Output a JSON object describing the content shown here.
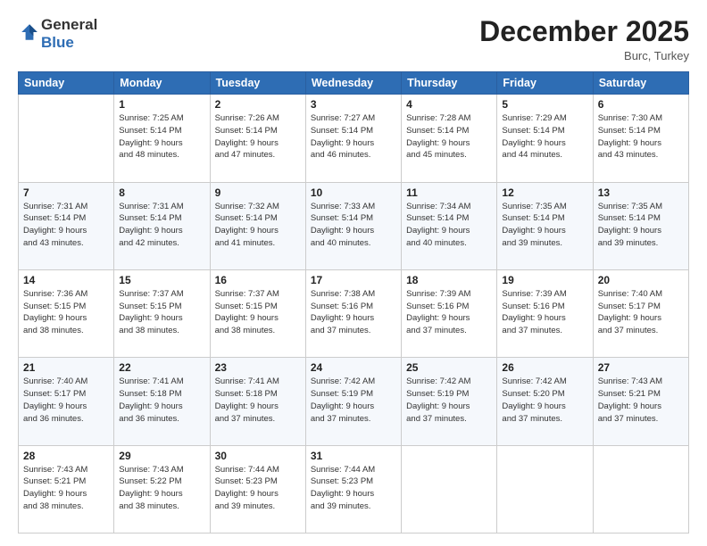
{
  "logo": {
    "line1": "General",
    "line2": "Blue"
  },
  "header": {
    "month": "December 2025",
    "location": "Burc, Turkey"
  },
  "days_of_week": [
    "Sunday",
    "Monday",
    "Tuesday",
    "Wednesday",
    "Thursday",
    "Friday",
    "Saturday"
  ],
  "weeks": [
    [
      {
        "day": "",
        "info": ""
      },
      {
        "day": "1",
        "info": "Sunrise: 7:25 AM\nSunset: 5:14 PM\nDaylight: 9 hours\nand 48 minutes."
      },
      {
        "day": "2",
        "info": "Sunrise: 7:26 AM\nSunset: 5:14 PM\nDaylight: 9 hours\nand 47 minutes."
      },
      {
        "day": "3",
        "info": "Sunrise: 7:27 AM\nSunset: 5:14 PM\nDaylight: 9 hours\nand 46 minutes."
      },
      {
        "day": "4",
        "info": "Sunrise: 7:28 AM\nSunset: 5:14 PM\nDaylight: 9 hours\nand 45 minutes."
      },
      {
        "day": "5",
        "info": "Sunrise: 7:29 AM\nSunset: 5:14 PM\nDaylight: 9 hours\nand 44 minutes."
      },
      {
        "day": "6",
        "info": "Sunrise: 7:30 AM\nSunset: 5:14 PM\nDaylight: 9 hours\nand 43 minutes."
      }
    ],
    [
      {
        "day": "7",
        "info": "Sunrise: 7:31 AM\nSunset: 5:14 PM\nDaylight: 9 hours\nand 43 minutes."
      },
      {
        "day": "8",
        "info": "Sunrise: 7:31 AM\nSunset: 5:14 PM\nDaylight: 9 hours\nand 42 minutes."
      },
      {
        "day": "9",
        "info": "Sunrise: 7:32 AM\nSunset: 5:14 PM\nDaylight: 9 hours\nand 41 minutes."
      },
      {
        "day": "10",
        "info": "Sunrise: 7:33 AM\nSunset: 5:14 PM\nDaylight: 9 hours\nand 40 minutes."
      },
      {
        "day": "11",
        "info": "Sunrise: 7:34 AM\nSunset: 5:14 PM\nDaylight: 9 hours\nand 40 minutes."
      },
      {
        "day": "12",
        "info": "Sunrise: 7:35 AM\nSunset: 5:14 PM\nDaylight: 9 hours\nand 39 minutes."
      },
      {
        "day": "13",
        "info": "Sunrise: 7:35 AM\nSunset: 5:14 PM\nDaylight: 9 hours\nand 39 minutes."
      }
    ],
    [
      {
        "day": "14",
        "info": "Sunrise: 7:36 AM\nSunset: 5:15 PM\nDaylight: 9 hours\nand 38 minutes."
      },
      {
        "day": "15",
        "info": "Sunrise: 7:37 AM\nSunset: 5:15 PM\nDaylight: 9 hours\nand 38 minutes."
      },
      {
        "day": "16",
        "info": "Sunrise: 7:37 AM\nSunset: 5:15 PM\nDaylight: 9 hours\nand 38 minutes."
      },
      {
        "day": "17",
        "info": "Sunrise: 7:38 AM\nSunset: 5:16 PM\nDaylight: 9 hours\nand 37 minutes."
      },
      {
        "day": "18",
        "info": "Sunrise: 7:39 AM\nSunset: 5:16 PM\nDaylight: 9 hours\nand 37 minutes."
      },
      {
        "day": "19",
        "info": "Sunrise: 7:39 AM\nSunset: 5:16 PM\nDaylight: 9 hours\nand 37 minutes."
      },
      {
        "day": "20",
        "info": "Sunrise: 7:40 AM\nSunset: 5:17 PM\nDaylight: 9 hours\nand 37 minutes."
      }
    ],
    [
      {
        "day": "21",
        "info": "Sunrise: 7:40 AM\nSunset: 5:17 PM\nDaylight: 9 hours\nand 36 minutes."
      },
      {
        "day": "22",
        "info": "Sunrise: 7:41 AM\nSunset: 5:18 PM\nDaylight: 9 hours\nand 36 minutes."
      },
      {
        "day": "23",
        "info": "Sunrise: 7:41 AM\nSunset: 5:18 PM\nDaylight: 9 hours\nand 37 minutes."
      },
      {
        "day": "24",
        "info": "Sunrise: 7:42 AM\nSunset: 5:19 PM\nDaylight: 9 hours\nand 37 minutes."
      },
      {
        "day": "25",
        "info": "Sunrise: 7:42 AM\nSunset: 5:19 PM\nDaylight: 9 hours\nand 37 minutes."
      },
      {
        "day": "26",
        "info": "Sunrise: 7:42 AM\nSunset: 5:20 PM\nDaylight: 9 hours\nand 37 minutes."
      },
      {
        "day": "27",
        "info": "Sunrise: 7:43 AM\nSunset: 5:21 PM\nDaylight: 9 hours\nand 37 minutes."
      }
    ],
    [
      {
        "day": "28",
        "info": "Sunrise: 7:43 AM\nSunset: 5:21 PM\nDaylight: 9 hours\nand 38 minutes."
      },
      {
        "day": "29",
        "info": "Sunrise: 7:43 AM\nSunset: 5:22 PM\nDaylight: 9 hours\nand 38 minutes."
      },
      {
        "day": "30",
        "info": "Sunrise: 7:44 AM\nSunset: 5:23 PM\nDaylight: 9 hours\nand 39 minutes."
      },
      {
        "day": "31",
        "info": "Sunrise: 7:44 AM\nSunset: 5:23 PM\nDaylight: 9 hours\nand 39 minutes."
      },
      {
        "day": "",
        "info": ""
      },
      {
        "day": "",
        "info": ""
      },
      {
        "day": "",
        "info": ""
      }
    ]
  ]
}
